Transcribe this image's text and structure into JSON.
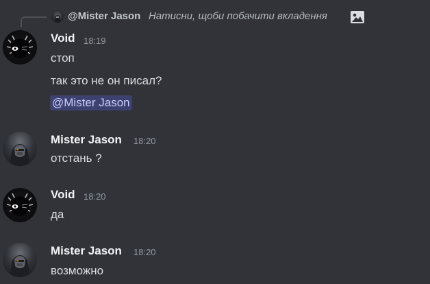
{
  "reply": {
    "author": "@Mister Jason",
    "text": "Натисни, щоби побачити вкладення",
    "icon": "image-icon"
  },
  "messages": [
    {
      "author": "Void",
      "time": "18:19",
      "lines": [
        "стоп",
        "так это не он писал?"
      ],
      "mention": "@Mister Jason"
    },
    {
      "author": "Mister Jason",
      "time": "18:20",
      "lines": [
        "отстань ?"
      ]
    },
    {
      "author": "Void",
      "time": "18:20",
      "lines": [
        "да"
      ]
    },
    {
      "author": "Mister Jason",
      "time": "18:20",
      "lines": [
        "возможно"
      ]
    }
  ]
}
